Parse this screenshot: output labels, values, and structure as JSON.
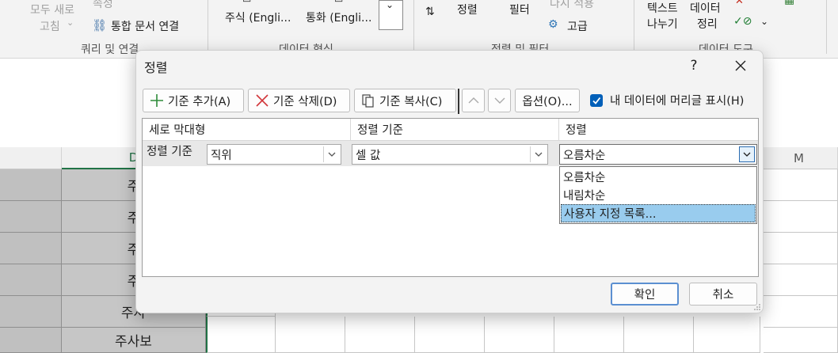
{
  "ribbon": {
    "refresh_all_label_1": "모두 새로",
    "refresh_all_label_2": "고침",
    "properties_label": "속성",
    "workbook_links_label": "통합 문서 연결",
    "group_queries": "쿼리 및 연결",
    "stocks_label": "주식 (Engli...",
    "currencies_label": "통화 (Engli...",
    "group_data_types": "데이터 형식",
    "sort_label": "정렬",
    "filter_label": "필터",
    "reapply_label": "다시 적용",
    "advanced_label": "고급",
    "group_sort_filter": "정렬 및 필터",
    "text_to_columns_1": "텍스트",
    "text_to_columns_2": "나누기",
    "data_tools_1": "데이터",
    "data_tools_2": "정리",
    "group_data_tools": "데이터 도구"
  },
  "sheet": {
    "col_header_d": "D",
    "col_header_m": "M",
    "cell_texts": [
      "주",
      "주",
      "주",
      "주",
      "주사",
      "주사보"
    ]
  },
  "dialog": {
    "title": "정렬",
    "help": "?",
    "toolbar": {
      "add_level": "기준 추가(A)",
      "delete_level": "기준 삭제(D)",
      "copy_level": "기준 복사(C)",
      "options": "옵션(O)...",
      "has_headers": "내 데이터에 머리글 표시(H)",
      "has_headers_checked": true
    },
    "grid": {
      "col_column": "세로 막대형",
      "col_sort_on": "정렬 기준",
      "col_order": "정렬",
      "row_label": "정렬 기준",
      "column_value": "직위",
      "sort_on_value": "셀 값",
      "order_value": "오름차순"
    },
    "dropdown_options": [
      "오름차순",
      "내림차순",
      "사용자 지정 목록..."
    ],
    "dropdown_selected_index": 2,
    "ok": "확인",
    "cancel": "취소"
  },
  "colors": {
    "accent": "#005fb8",
    "selection": "#99ccee",
    "dialog_bg": "#f3f3f3"
  }
}
